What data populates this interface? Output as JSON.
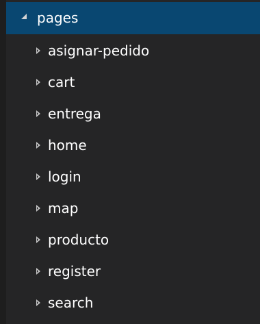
{
  "explorer": {
    "folder": {
      "label": "pages",
      "expanded": true,
      "icon": "chevron-expanded-icon"
    },
    "children": [
      {
        "label": "asignar-pedido",
        "icon": "chevron-right-icon"
      },
      {
        "label": "cart",
        "icon": "chevron-right-icon"
      },
      {
        "label": "entrega",
        "icon": "chevron-right-icon"
      },
      {
        "label": "home",
        "icon": "chevron-right-icon"
      },
      {
        "label": "login",
        "icon": "chevron-right-icon"
      },
      {
        "label": "map",
        "icon": "chevron-right-icon"
      },
      {
        "label": "producto",
        "icon": "chevron-right-icon"
      },
      {
        "label": "register",
        "icon": "chevron-right-icon"
      },
      {
        "label": "search",
        "icon": "chevron-right-icon"
      }
    ]
  },
  "colors": {
    "background": "#252526",
    "selection": "#094771",
    "text": "#ffffff"
  }
}
